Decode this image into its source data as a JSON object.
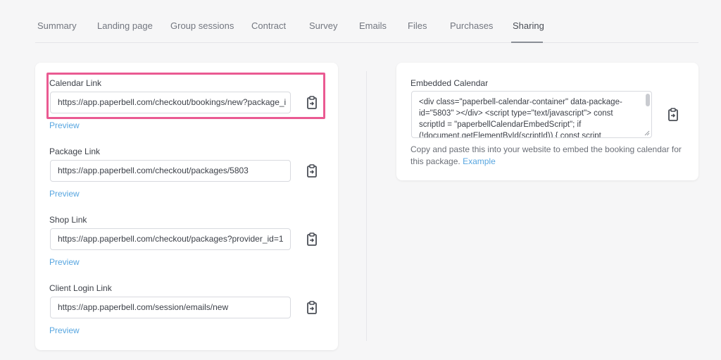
{
  "tabs": [
    {
      "label": "Summary"
    },
    {
      "label": "Landing page"
    },
    {
      "label": "Group sessions"
    },
    {
      "label": "Contract"
    },
    {
      "label": "Survey"
    },
    {
      "label": "Emails"
    },
    {
      "label": "Files"
    },
    {
      "label": "Purchases"
    },
    {
      "label": "Sharing"
    }
  ],
  "active_tab": "Sharing",
  "links": {
    "calendar": {
      "label": "Calendar Link",
      "value": "https://app.paperbell.com/checkout/bookings/new?package_i",
      "preview": "Preview",
      "copy_icon": "clipboard-icon"
    },
    "package": {
      "label": "Package Link",
      "value": "https://app.paperbell.com/checkout/packages/5803",
      "preview": "Preview",
      "copy_icon": "clipboard-icon"
    },
    "shop": {
      "label": "Shop Link",
      "value": "https://app.paperbell.com/checkout/packages?provider_id=1",
      "preview": "Preview",
      "copy_icon": "clipboard-icon"
    },
    "client_login": {
      "label": "Client Login Link",
      "value": "https://app.paperbell.com/session/emails/new",
      "preview": "Preview",
      "copy_icon": "clipboard-icon"
    }
  },
  "embedded": {
    "label": "Embedded Calendar",
    "code": "<div class=\"paperbell-calendar-container\" data-package-id=\"5803\" ></div> <script type=\"text/javascript\"> const scriptId = \"paperbellCalendarEmbedScript\"; if (!document.getElementById(scriptId)) { const script",
    "helper_text": "Copy and paste this into your website to embed the booking calendar for this package.",
    "helper_link": "Example",
    "copy_icon": "clipboard-icon"
  },
  "colors": {
    "accent_link": "#58a6e0",
    "highlight": "#ea5a92",
    "background": "#f6f6f7"
  }
}
